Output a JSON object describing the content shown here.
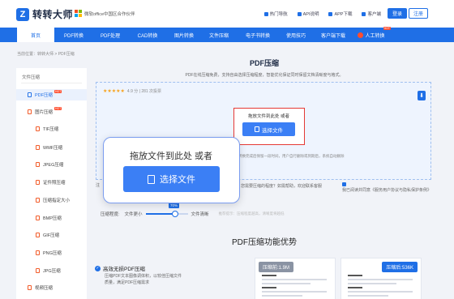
{
  "header": {
    "logo_text": "转转大师",
    "logo_mark": "Z",
    "partner": "微软office中国区合作伙伴",
    "links": [
      "热门导航",
      "API说明",
      "APP下载",
      "客户端"
    ],
    "login": "登录",
    "register": "注册"
  },
  "nav": {
    "items": [
      "首页",
      "PDF转换",
      "PDF处理",
      "CAD转换",
      "图片转换",
      "文件压缩",
      "电子书转换",
      "使用技巧",
      "客户端下载",
      "人工转换"
    ],
    "hot_badge": "HOT"
  },
  "breadcrumb": "当前位置：转转大师 > PDF压缩",
  "sidebar": {
    "heading": "文件压缩",
    "items": [
      "PDF压缩",
      "图片压缩",
      "TIF压缩",
      "WMF压缩",
      "JPEG压缩",
      "证件照压缩",
      "压缩指定大小",
      "BMP压缩",
      "GIF压缩",
      "PNG压缩",
      "JPG压缩",
      "视频压缩"
    ],
    "hot_badge": "HOT"
  },
  "main": {
    "title": "PDF压缩",
    "description": "PDF在线压缩免费，支持自由选择压缩程度，智能优化保证同时保留文档清晰度与格式。",
    "rating_value": "4.9",
    "rating_text": "4.9 分 | 281 次投票",
    "drop_text": "拖放文件到此处 或者",
    "select_button": "选择文件",
    "note": "转换完成后保留一段时间，用户自行删除或到期后，系统自动删除",
    "note_prefix": "注",
    "compress_question": "您需要压缩的程度？如需帮助，欢迎联系客服",
    "agree_text": "我已阅读并同意《服务用户协议与隐私保护条例》",
    "slider": {
      "label": "压缩程度:",
      "left": "文件更小",
      "right": "文件清晰",
      "value": "70%",
      "level": 0.7,
      "hint": "推荐提示：压缩程度越高，清晰度将越低"
    },
    "advantages_title": "PDF压缩功能优势",
    "feature": {
      "title": "高效无损PDF压缩",
      "desc": "压缩PDF文本图像调体积，以较佳压缩文件质量，满足PDF压缩需求"
    },
    "cards": [
      {
        "tag": "压缩前:1.9M",
        "color": "#8a93a3"
      },
      {
        "tag": "压缩后:536K",
        "color": "#1f6fe6"
      }
    ]
  },
  "popup": {
    "text": "拖放文件到此处 或者",
    "button": "选择文件"
  },
  "colors": {
    "accent": "#1f6fe6",
    "hot": "#ff4d2e",
    "highlight": "#e53935"
  }
}
